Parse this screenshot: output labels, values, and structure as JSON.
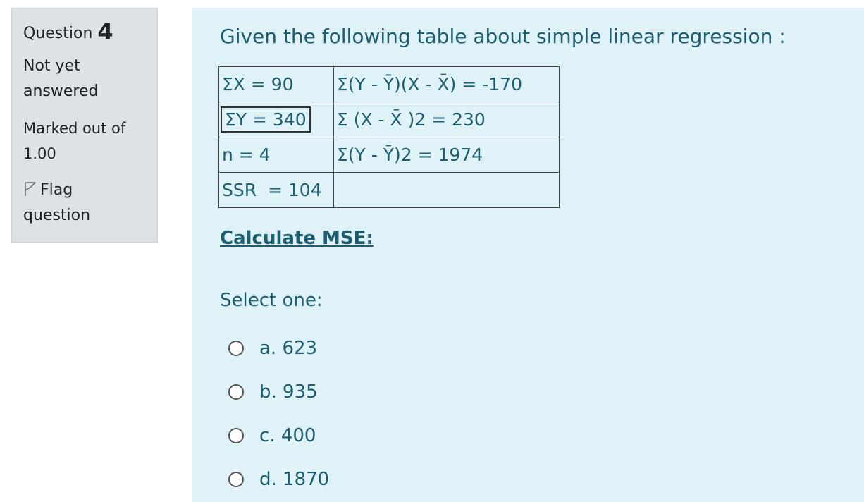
{
  "info": {
    "question_label": "Question",
    "question_number": "4",
    "state_line1": "Not yet",
    "state_line2": "answered",
    "grade_line1": "Marked out of",
    "grade_line2": "1.00",
    "flag_line1": "Flag",
    "flag_line2": "question",
    "flag_icon": "flag-outline-icon"
  },
  "question": {
    "text": "Given the following table about simple linear regression :",
    "table": [
      [
        "ΣX = 90",
        "Σ(Y - Ȳ)(X - X̄) = -170"
      ],
      [
        "ΣY = 340",
        "Σ (X - X̄ )2 = 230"
      ],
      [
        "n = 4",
        "Σ(Y - Ȳ)2 = 1974"
      ],
      [
        "SSR  = 104",
        ""
      ]
    ],
    "prompt": "Calculate MSE:"
  },
  "answer": {
    "select_label": "Select one:",
    "options": [
      {
        "label": "a. 623",
        "selected": false
      },
      {
        "label": "b. 935",
        "selected": false
      },
      {
        "label": "c. 400",
        "selected": false
      },
      {
        "label": "d. 1870",
        "selected": false
      }
    ]
  },
  "colors": {
    "content_bg": "#def2f8",
    "info_bg": "#dee2e6",
    "text_accent": "#1c5d70"
  }
}
